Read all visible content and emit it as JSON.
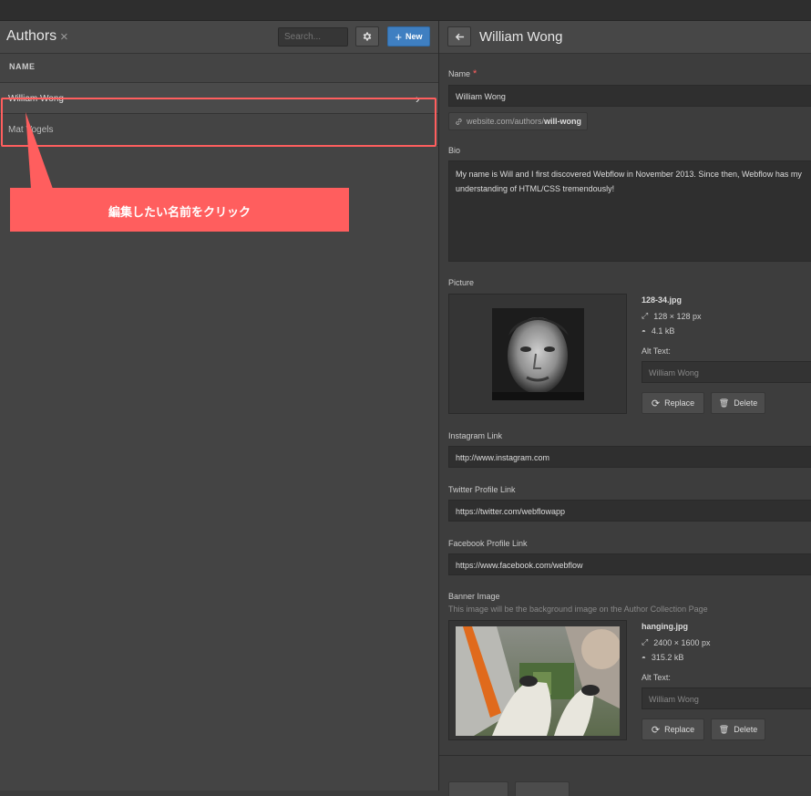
{
  "left": {
    "title": "Authors",
    "close": "×",
    "search_placeholder": "Search...",
    "new_label": "New",
    "column": "NAME",
    "rows": [
      {
        "name": "William Wong"
      },
      {
        "name": "Mat Vogels"
      }
    ],
    "callout": "編集したい名前をクリック",
    "highlight_color": "#ff5e5e",
    "accent": "#3f7fc1"
  },
  "right": {
    "title": "William Wong",
    "name_label": "Name",
    "required_mark": "*",
    "name_value": "William Wong",
    "slug_base": "website.com/authors/",
    "slug_value": "will-wong",
    "bio_label": "Bio",
    "bio_value": "My name is Will and I first discovered Webflow in November 2013. Since then, Webflow has my understanding of HTML/CSS tremendously!",
    "picture": {
      "label": "Picture",
      "file": "128-34.jpg",
      "dims": "128 × 128 px",
      "size": "4.1 kB",
      "alt_label": "Alt Text:",
      "alt_placeholder": "William Wong",
      "replace": "Replace",
      "delete": "Delete"
    },
    "instagram_label": "Instagram Link",
    "instagram_value": "http://www.instagram.com",
    "twitter_label": "Twitter Profile Link",
    "twitter_value": "https://twitter.com/webflowapp",
    "facebook_label": "Facebook Profile Link",
    "facebook_value": "https://www.facebook.com/webflow",
    "banner": {
      "label": "Banner Image",
      "hint": "This image will be the background image on the Author Collection Page",
      "file": "hanging.jpg",
      "dims": "2400 × 1600 px",
      "size": "315.2 kB",
      "alt_label": "Alt Text:",
      "alt_placeholder": "William Wong",
      "replace": "Replace",
      "delete": "Delete"
    }
  }
}
